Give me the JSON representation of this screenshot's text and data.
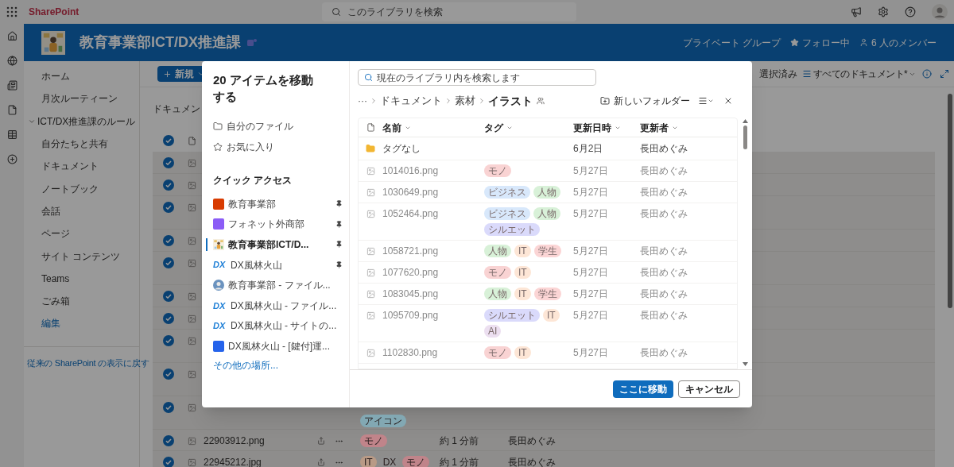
{
  "top_bar": {
    "brand": "SharePoint",
    "search": {
      "placeholder": "このライブラリを検索"
    }
  },
  "site": {
    "title": "教育事業部ICT/DX推進課",
    "privacy": "プライベート グループ",
    "follow": {
      "label": "フォロー中",
      "on": true
    },
    "members": "6 人のメンバー"
  },
  "nav": {
    "items": [
      {
        "label": "ホーム",
        "kind": "page"
      },
      {
        "label": "月次ルーティーン",
        "kind": "page"
      },
      {
        "label": "ICT/DX推進課のルール",
        "kind": "group",
        "expanded": true
      },
      {
        "label": "自分たちと共有",
        "kind": "page"
      },
      {
        "label": "ドキュメント",
        "kind": "page"
      },
      {
        "label": "ノートブック",
        "kind": "page"
      },
      {
        "label": "会話",
        "kind": "page"
      },
      {
        "label": "ページ",
        "kind": "page"
      },
      {
        "label": "サイト コンテンツ",
        "kind": "page"
      },
      {
        "label": "Teams",
        "kind": "page"
      },
      {
        "label": "ごみ箱",
        "kind": "page"
      },
      {
        "label": "編集",
        "kind": "link"
      }
    ],
    "footer_link": "従来の SharePoint の表示に戻す"
  },
  "command_bar": {
    "new_button": "新規",
    "selection": "選択済み",
    "view": "すべてのドキュメント*"
  },
  "library": {
    "title": "ドキュメン",
    "header_selected": true,
    "rows": [
      {
        "selected": true
      },
      {
        "selected": true
      },
      {
        "selected": true
      },
      {
        "selected": true
      },
      {
        "selected": true
      },
      {
        "selected": true
      },
      {
        "selected": true
      },
      {
        "selected": true
      },
      {
        "selected": true
      },
      {
        "selected": true,
        "tags": [
          {
            "label": "アイコン",
            "color": "#82a8b3"
          }
        ]
      },
      {
        "selected": true,
        "name": "22903912.png",
        "tags": [
          {
            "label": "モノ",
            "color": "#c0848a"
          }
        ],
        "modified": "約 1 分前",
        "modified_by": "長田めぐみ"
      },
      {
        "selected": true,
        "name": "22945212.jpg",
        "tags": [
          {
            "label": "IT",
            "color": "#b89a86"
          },
          {
            "label": "DX",
            "color": "#8e8e8e"
          },
          {
            "label": "モノ",
            "color": "#c0848a"
          }
        ],
        "modified": "約 1 分前",
        "modified_by": "長田めぐみ"
      }
    ]
  },
  "dialog": {
    "title": "20 アイテムを移動する",
    "places": [
      {
        "label": "自分のファイル",
        "kind": "files"
      },
      {
        "label": "お気に入り",
        "kind": "favorites"
      }
    ],
    "quick_access": {
      "heading": "クイック アクセス",
      "items": [
        {
          "label": "教育事業部",
          "kind": "square",
          "color": "#d83b01",
          "pinned": true,
          "selected": false
        },
        {
          "label": "フォネット外商部",
          "kind": "square",
          "color": "#8b5cf6",
          "pinned": true,
          "selected": false
        },
        {
          "label": "教育事業部ICT/D...",
          "kind": "picture",
          "pinned": true,
          "selected": true
        },
        {
          "label": "DX風林火山",
          "kind": "logo",
          "logo_text": "DX",
          "pinned": true,
          "selected": false
        },
        {
          "label": "教育事業部 - ファイル...",
          "kind": "avatar",
          "pinned": false,
          "selected": false
        },
        {
          "label": "DX風林火山 - ファイル...",
          "kind": "logo",
          "logo_text": "DX",
          "pinned": false,
          "selected": false
        },
        {
          "label": "DX風林火山 - サイトの...",
          "kind": "logo",
          "logo_text": "DX",
          "pinned": false,
          "selected": false
        },
        {
          "label": "DX風林火山 - [鍵付]運...",
          "kind": "square",
          "color": "#2563eb",
          "pinned": false,
          "selected": false
        }
      ]
    },
    "more_link": "その他の場所...",
    "search": {
      "placeholder": "現在のライブラリ内を検索します"
    },
    "breadcrumb": {
      "overflow": "···",
      "items": [
        {
          "label": "ドキュメント",
          "current": false
        },
        {
          "label": "素材",
          "current": false
        },
        {
          "label": "イラスト",
          "current": true
        }
      ]
    },
    "new_folder": "新しいフォルダー",
    "columns": [
      "名前",
      "タグ",
      "更新日時",
      "更新者"
    ],
    "rows": [
      {
        "kind": "folder",
        "name": "タグなし",
        "modified": "6月2日",
        "modified_by": "長田めぐみ",
        "disabled": false
      },
      {
        "kind": "file",
        "name": "1014016.png",
        "tags": [
          {
            "label": "モノ",
            "color": "#f9d3d3"
          }
        ],
        "modified": "5月27日",
        "modified_by": "長田めぐみ",
        "disabled": true
      },
      {
        "kind": "file",
        "name": "1030649.png",
        "tags": [
          {
            "label": "ビジネス",
            "color": "#d8e8fb"
          },
          {
            "label": "人物",
            "color": "#d8f1d8"
          }
        ],
        "modified": "5月27日",
        "modified_by": "長田めぐみ",
        "disabled": true
      },
      {
        "kind": "file",
        "name": "1052464.png",
        "tags": [
          {
            "label": "ビジネス",
            "color": "#d8e8fb"
          },
          {
            "label": "人物",
            "color": "#d8f1d8"
          },
          {
            "label": "シルエット",
            "color": "#dadafb"
          }
        ],
        "modified": "5月27日",
        "modified_by": "長田めぐみ",
        "disabled": true
      },
      {
        "kind": "file",
        "name": "1058721.png",
        "tags": [
          {
            "label": "人物",
            "color": "#d8f1d8"
          },
          {
            "label": "IT",
            "color": "#fde6d6"
          },
          {
            "label": "学生",
            "color": "#fbd5d5"
          }
        ],
        "modified": "5月27日",
        "modified_by": "長田めぐみ",
        "disabled": true
      },
      {
        "kind": "file",
        "name": "1077620.png",
        "tags": [
          {
            "label": "モノ",
            "color": "#f9d3d3"
          },
          {
            "label": "IT",
            "color": "#fde6d6"
          }
        ],
        "modified": "5月27日",
        "modified_by": "長田めぐみ",
        "disabled": true
      },
      {
        "kind": "file",
        "name": "1083045.png",
        "tags": [
          {
            "label": "人物",
            "color": "#d8f1d8"
          },
          {
            "label": "IT",
            "color": "#fde6d6"
          },
          {
            "label": "学生",
            "color": "#fbd5d5"
          }
        ],
        "modified": "5月27日",
        "modified_by": "長田めぐみ",
        "disabled": true
      },
      {
        "kind": "file",
        "name": "1095709.png",
        "tags": [
          {
            "label": "シルエット",
            "color": "#dadafb"
          },
          {
            "label": "IT",
            "color": "#fde6d6"
          },
          {
            "label": "AI",
            "color": "#ecdff0"
          }
        ],
        "modified": "5月27日",
        "modified_by": "長田めぐみ",
        "disabled": true
      },
      {
        "kind": "file",
        "name": "1102830.png",
        "tags": [
          {
            "label": "モノ",
            "color": "#f9d3d3"
          },
          {
            "label": "IT",
            "color": "#fde6d6"
          }
        ],
        "modified": "5月27日",
        "modified_by": "長田めぐみ",
        "disabled": true
      }
    ],
    "buttons": {
      "primary": "ここに移動",
      "secondary": "キャンセル"
    }
  }
}
